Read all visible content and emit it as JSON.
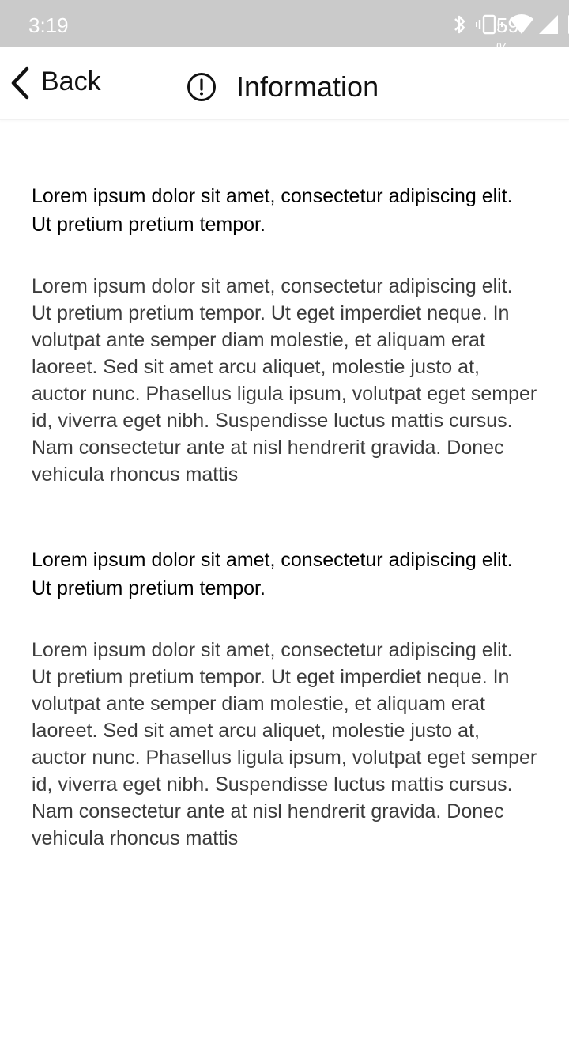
{
  "status_bar": {
    "time": "3:19",
    "battery": "59",
    "battery_suffix": "%",
    "icons": [
      "bluetooth-icon",
      "vibrate-icon",
      "wifi-icon",
      "signal-icon",
      "battery-icon"
    ]
  },
  "nav": {
    "back_label": "Back",
    "title": "Information",
    "title_icon": "info-circle-icon"
  },
  "sections": [
    {
      "heading": "Lorem ipsum dolor sit amet, consectetur adipiscing elit. Ut pretium pretium tempor.",
      "body": "Lorem ipsum dolor sit amet, consectetur adipiscing elit. Ut pretium pretium tempor. Ut eget imperdiet neque. In volutpat ante semper diam molestie, et aliquam erat laoreet. Sed sit amet arcu aliquet, molestie justo at, auctor nunc. Phasellus ligula ipsum, volutpat eget semper id, viverra eget nibh. Suspendisse luctus mattis cursus. Nam consectetur ante at nisl hendrerit gravida. Donec vehicula rhoncus mattis"
    },
    {
      "heading": "Lorem ipsum dolor sit amet, consectetur adipiscing elit. Ut pretium pretium tempor.",
      "body": "Lorem ipsum dolor sit amet, consectetur adipiscing elit. Ut pretium pretium tempor. Ut eget imperdiet neque. In volutpat ante semper diam molestie, et aliquam erat laoreet. Sed sit amet arcu aliquet, molestie justo at, auctor nunc. Phasellus ligula ipsum, volutpat eget semper id, viverra eget nibh. Suspendisse luctus mattis cursus. Nam consectetur ante at nisl hendrerit gravida. Donec vehicula rhoncus mattis"
    }
  ],
  "colors": {
    "status_bar_bg": "#cacaca",
    "heading_text": "#000000",
    "body_text": "#3c3c3c",
    "background": "#ffffff"
  }
}
